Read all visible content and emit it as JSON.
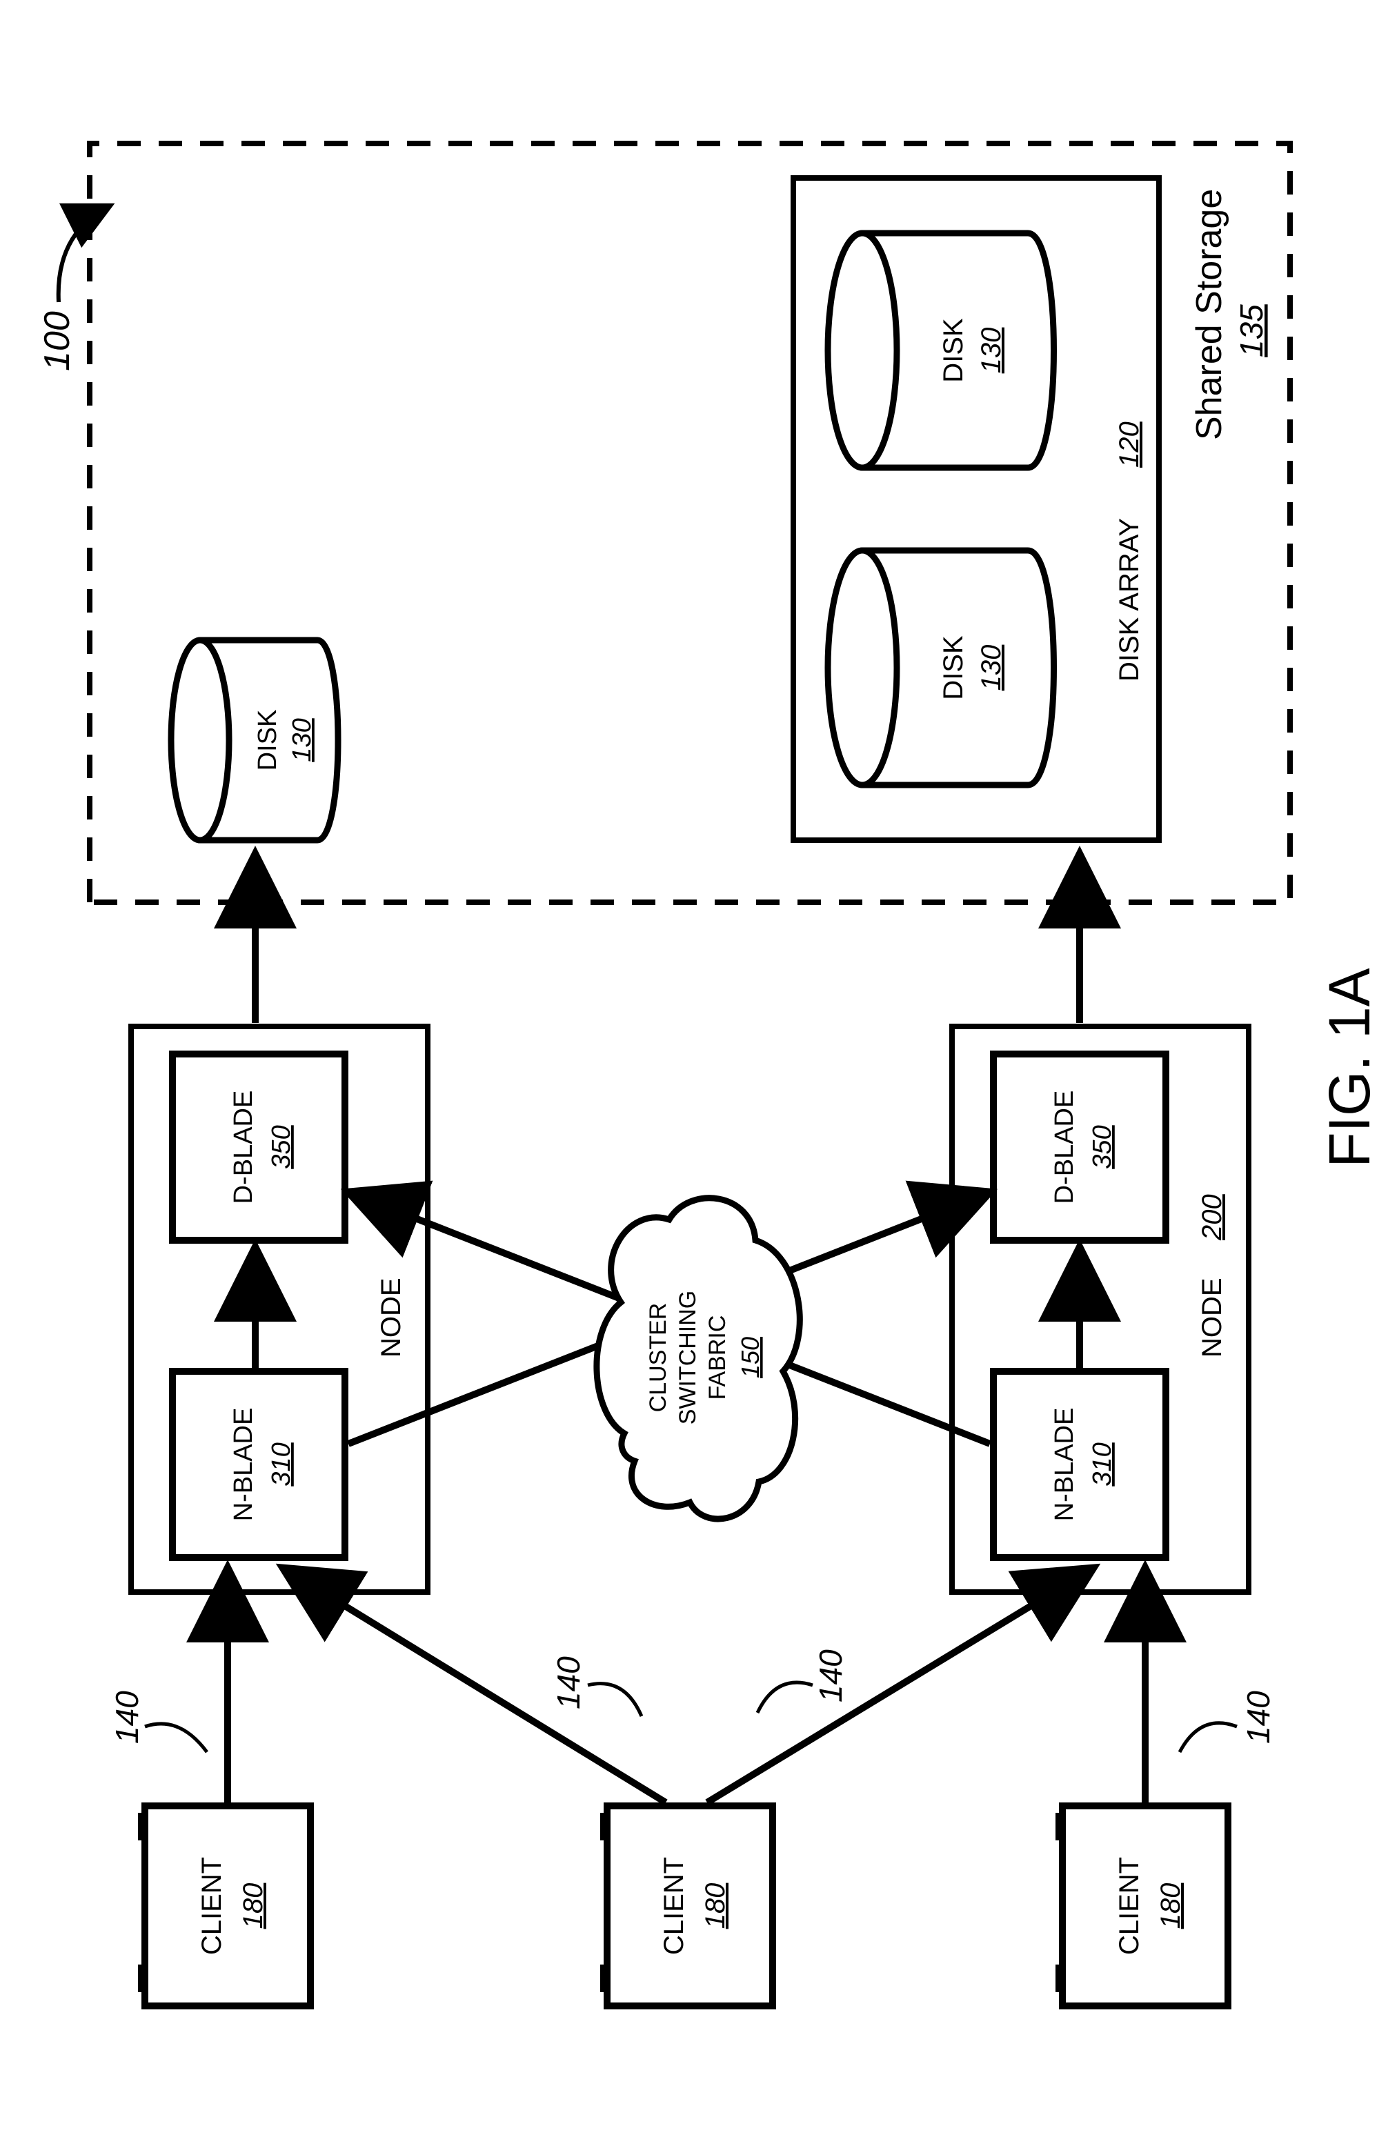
{
  "figure_label": "FIG. 1A",
  "system_ref": "100",
  "client": {
    "label": "CLIENT",
    "ref": "180"
  },
  "link_ref": "140",
  "node": {
    "label": "NODE",
    "ref": "200"
  },
  "nblade": {
    "label": "N-BLADE",
    "ref": "310"
  },
  "dblade": {
    "label": "D-BLADE",
    "ref": "350"
  },
  "fabric": {
    "line1": "CLUSTER",
    "line2": "SWITCHING",
    "line3": "FABRIC",
    "ref": "150"
  },
  "disk": {
    "label": "DISK",
    "ref": "130"
  },
  "diskarray": {
    "label": "DISK ARRAY",
    "ref": "120"
  },
  "shared": {
    "label": "Shared Storage",
    "ref": "135"
  }
}
